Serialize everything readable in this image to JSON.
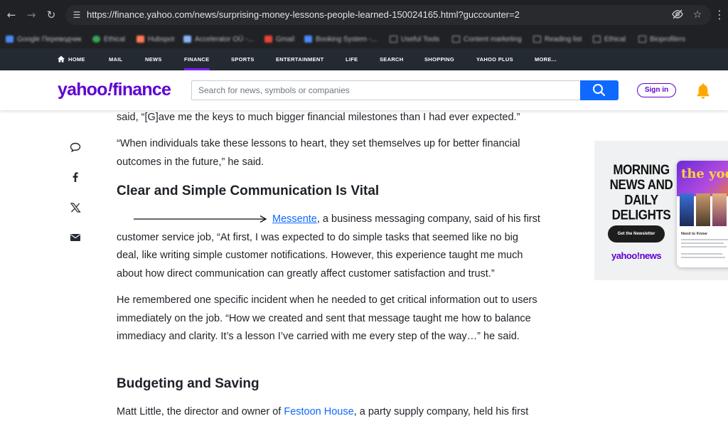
{
  "browser": {
    "url": "https://finance.yahoo.com/news/surprising-money-lessons-people-learned-150024165.html?guccounter=2",
    "back_icon": "back-arrow-icon",
    "forward_icon": "forward-arrow-icon",
    "reload_icon": "reload-icon",
    "bookmarks": [
      "Google Переводчик",
      "Ethical",
      "Hubspot",
      "Accelerator OÜ -...",
      "Gmail",
      "Booking System -...",
      "Useful Tools",
      "Content marketing",
      "Reading list",
      "Ethical",
      "Bioprofilers"
    ]
  },
  "yahoo_nav": {
    "items": [
      "HOME",
      "MAIL",
      "NEWS",
      "FINANCE",
      "SPORTS",
      "ENTERTAINMENT",
      "LIFE",
      "SEARCH",
      "SHOPPING",
      "YAHOO PLUS",
      "MORE..."
    ],
    "active": "FINANCE",
    "accent_color": "#7e1fff"
  },
  "header": {
    "logo_part1": "yahoo",
    "logo_bang": "!",
    "logo_part2": "finance",
    "search_placeholder": "Search for news, symbols or companies",
    "signin_label": "Sign in",
    "brand_color": "#5f01d1",
    "search_button_color": "#0f69ff"
  },
  "share_icons": [
    "comment-icon",
    "facebook-icon",
    "x-icon",
    "mail-icon"
  ],
  "article": {
    "p1": "said, “[G]ave me the keys to much bigger financial milestones than I had ever expected.”",
    "p2": "“When individuals take these lessons to heart, they set themselves up for better financial outcomes in the future,” he said.",
    "heading1": "Clear and Simple Communication Is Vital",
    "p3_link": "Messente",
    "p3_rest": ", a business messaging company, said of his first customer service job, “At first, I was expected to do simple tasks that seemed like no big deal, like writing simple customer notifications. However, this experience taught me much about how direct communication can greatly affect customer satisfaction and trust.”",
    "p4": "He remembered one specific incident when he needed to get critical information out to users immediately on the job. “How we created and sent that message taught me how to balance immediacy and clarity. It’s a lesson I’ve carried with me every step of the way…” he said.",
    "heading2": "Budgeting and Saving",
    "p5_prefix": "Matt Little, the director and owner of ",
    "p5_link": "Festoon House",
    "p5_suffix": ", a party supply company, held his first"
  },
  "ad": {
    "headline_lines": [
      "MORNING",
      "NEWS AND",
      "DAILY",
      "DELIGHTS"
    ],
    "cta": "Get the Newsletter",
    "brand": "yahoo!news",
    "phone_title": "the yode",
    "phone_label": "Need to Know"
  }
}
